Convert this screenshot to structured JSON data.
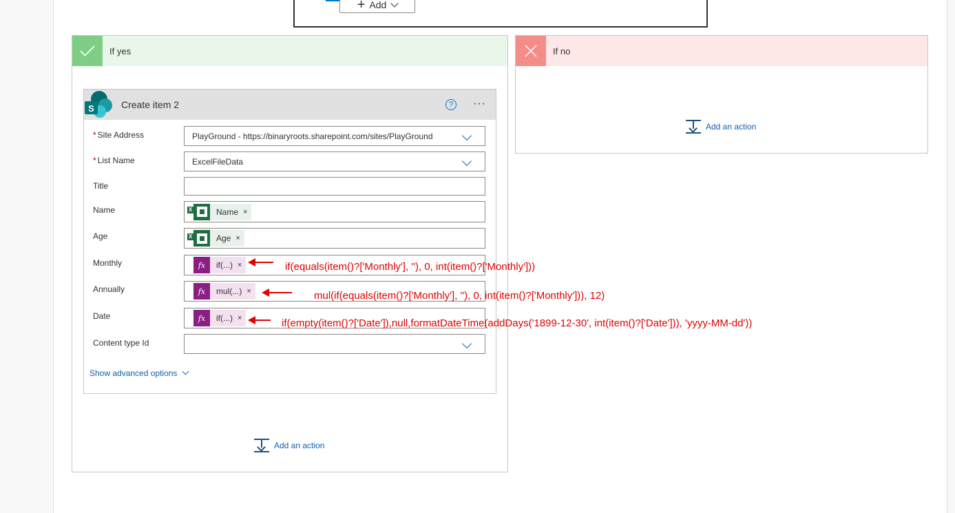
{
  "top": {
    "add_button_label": "Add"
  },
  "if_yes": {
    "title": "If yes",
    "add_action_label": "Add an action"
  },
  "if_no": {
    "title": "If no",
    "add_action_label": "Add an action"
  },
  "action_card": {
    "title": "Create item 2",
    "help_symbol": "?",
    "more_symbol": "···",
    "required_marker": "*",
    "fields": {
      "site_address": {
        "label": "Site Address",
        "value": "PlayGround - https://binaryroots.sharepoint.com/sites/PlayGround"
      },
      "list_name": {
        "label": "List Name",
        "value": "ExcelFileData"
      },
      "title": {
        "label": "Title",
        "value": ""
      },
      "name": {
        "label": "Name",
        "token": "Name"
      },
      "age": {
        "label": "Age",
        "token": "Age"
      },
      "monthly": {
        "label": "Monthly",
        "token": "if(...)"
      },
      "annually": {
        "label": "Annually",
        "token": "mul(...)"
      },
      "date": {
        "label": "Date",
        "token": "if(...)"
      },
      "content_type_id": {
        "label": "Content type Id",
        "value": ""
      }
    },
    "token_close": "×",
    "expression_icon_text": "fx",
    "show_advanced_label": "Show advanced options"
  },
  "annotations": {
    "monthly": "if(equals(item()?['Monthly'], ''), 0, int(item()?['Monthly']))",
    "annually": "mul(if(equals(item()?['Monthly'], ''), 0, int(item()?['Monthly'])), 12)",
    "date": "if(empty(item()?['Date']),null,formatDateTime(addDays('1899-12-30', int(item()?['Date'])), 'yyyy-MM-dd'))"
  },
  "colors": {
    "yes_header": "#e9f7ea",
    "yes_icon": "#7fce85",
    "no_header": "#fde7e7",
    "no_icon": "#f48c88",
    "excel_green": "#1d6f42",
    "expression_purple": "#8b1e84",
    "link_blue": "#0f5fad",
    "annotation_red": "#e00000"
  }
}
